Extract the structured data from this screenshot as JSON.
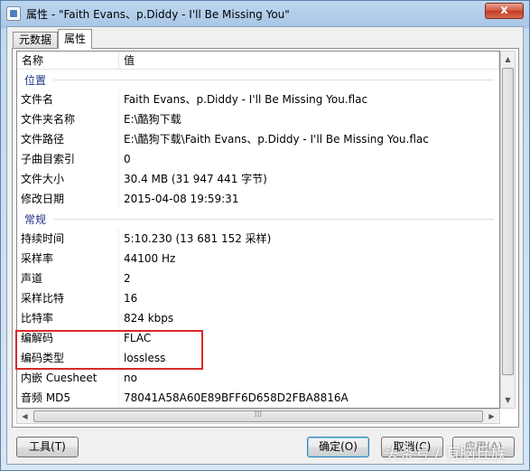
{
  "window": {
    "title": "属性 - \"Faith Evans、p.Diddy - I'll Be Missing You\"",
    "close_label": "x"
  },
  "tabs": [
    {
      "label": "元数据",
      "active": false
    },
    {
      "label": "属性",
      "active": true
    }
  ],
  "list": {
    "columns": [
      "名称",
      "值"
    ],
    "groups": [
      {
        "title": "位置",
        "rows": [
          {
            "name": "文件名",
            "value": "Faith Evans、p.Diddy - I'll Be Missing You.flac"
          },
          {
            "name": "文件夹名称",
            "value": "E:\\酷狗下载"
          },
          {
            "name": "文件路径",
            "value": "E:\\酷狗下载\\Faith Evans、p.Diddy - I'll Be Missing You.flac"
          },
          {
            "name": "子曲目索引",
            "value": "0"
          },
          {
            "name": "文件大小",
            "value": "30.4 MB (31 947 441 字节)"
          },
          {
            "name": "修改日期",
            "value": "2015-04-08 19:59:31"
          }
        ]
      },
      {
        "title": "常规",
        "rows": [
          {
            "name": "持续时间",
            "value": "5:10.230 (13 681 152 采样)"
          },
          {
            "name": "采样率",
            "value": "44100 Hz"
          },
          {
            "name": "声道",
            "value": "2"
          },
          {
            "name": "采样比特",
            "value": "16"
          },
          {
            "name": "比特率",
            "value": "824 kbps"
          },
          {
            "name": "编解码",
            "value": "FLAC"
          },
          {
            "name": "编码类型",
            "value": "lossless"
          },
          {
            "name": "内嵌 Cuesheet",
            "value": "no"
          },
          {
            "name": "音频 MD5",
            "value": "78041A58A60E89BFF6D658D2FBA8816A"
          }
        ]
      }
    ]
  },
  "buttons": {
    "tools": "工具(T)",
    "ok": "确定(O)",
    "cancel": "取消(C)",
    "apply": "应用(A)"
  },
  "watermark": "头条号 / 有脑丘族",
  "colors": {
    "highlight": "#d9292b",
    "group_title": "#1e3287"
  }
}
